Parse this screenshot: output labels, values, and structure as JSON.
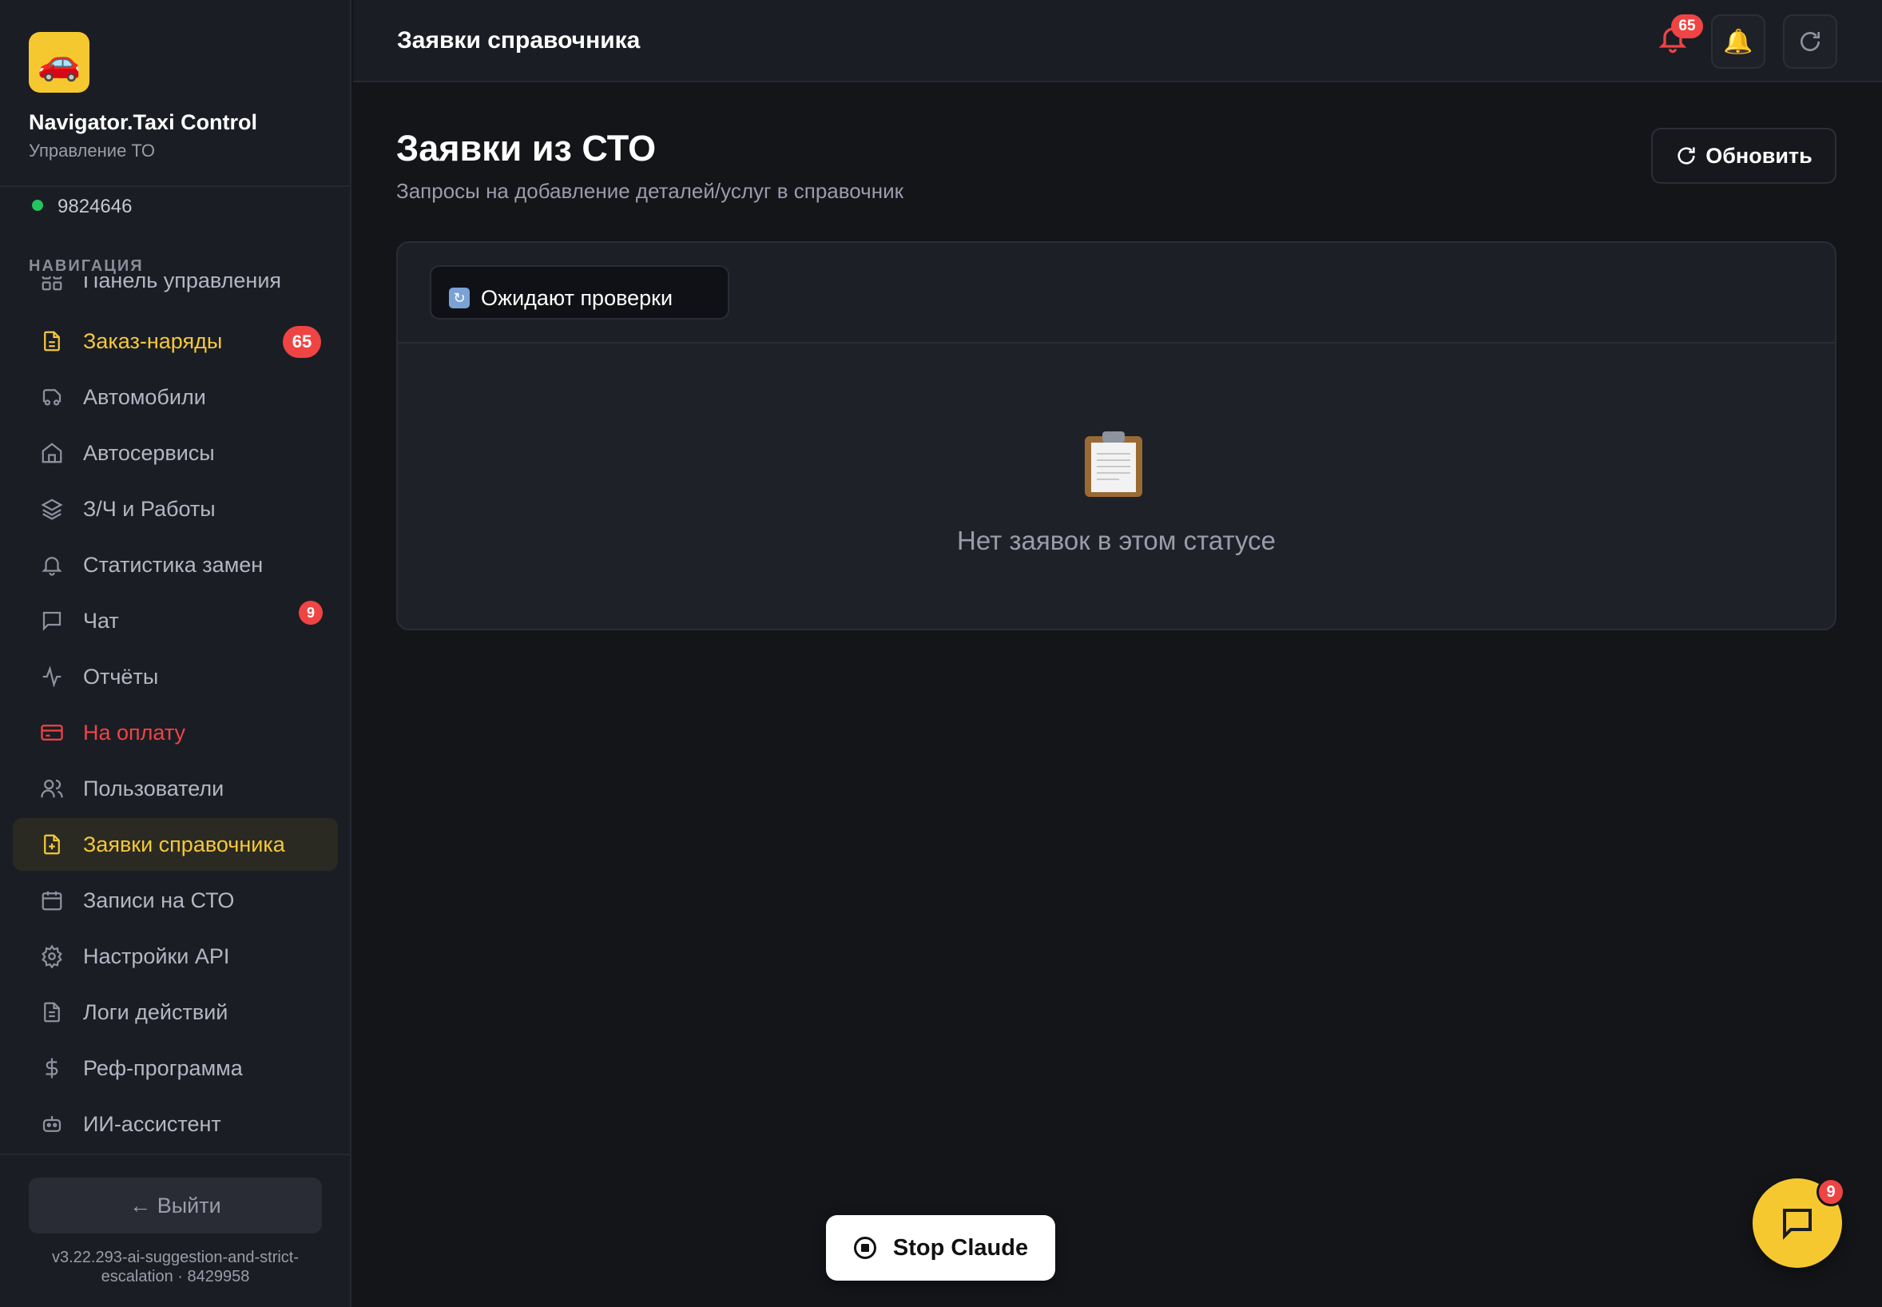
{
  "brand": {
    "name": "Navigator.Taxi Control",
    "subtitle": "Управление ТО",
    "logo_icon": "car-icon"
  },
  "status": {
    "id": "9824646",
    "color": "#22c55e"
  },
  "nav": {
    "heading": "НАВИГАЦИЯ",
    "items": [
      {
        "label": "Панель управления",
        "icon": "dashboard-icon"
      },
      {
        "label": "Заказ-наряды",
        "icon": "document-icon",
        "badge": "65"
      },
      {
        "label": "Автомобили",
        "icon": "car-icon"
      },
      {
        "label": "Автосервисы",
        "icon": "garage-icon"
      },
      {
        "label": "З/Ч и Работы",
        "icon": "layers-icon"
      },
      {
        "label": "Статистика замен",
        "icon": "bell-icon"
      },
      {
        "label": "Чат",
        "icon": "chat-icon",
        "badge": "9"
      },
      {
        "label": "Отчёты",
        "icon": "activity-icon"
      },
      {
        "label": "На оплату",
        "icon": "credit-card-icon"
      },
      {
        "label": "Пользователи",
        "icon": "users-icon"
      },
      {
        "label": "Заявки справочника",
        "icon": "file-plus-icon",
        "active": true
      },
      {
        "label": "Записи на СТО",
        "icon": "calendar-icon"
      },
      {
        "label": "Настройки API",
        "icon": "gear-icon"
      },
      {
        "label": "Логи действий",
        "icon": "file-text-icon"
      },
      {
        "label": "Реф-программа",
        "icon": "dollar-icon"
      },
      {
        "label": "ИИ-ассистент",
        "icon": "robot-icon"
      }
    ]
  },
  "logout_label": "← Выйти",
  "version_text": "v3.22.293-ai-suggestion-and-strict-escalation · 8429958",
  "topbar": {
    "title": "Заявки справочника",
    "notification_count": "65"
  },
  "main": {
    "title": "Заявки из СТО",
    "subtitle": "Запросы на добавление деталей/услуг в справочник",
    "refresh_label": "Обновить",
    "status_filter": "Ожидают проверки",
    "empty_text": "Нет заявок в этом статусе"
  },
  "stop_label": "Stop Claude",
  "chat_badge": "9",
  "colors": {
    "accent": "#f5c83a",
    "danger": "#ef4444",
    "background": "#141519",
    "sidebar": "#1b1d24"
  }
}
